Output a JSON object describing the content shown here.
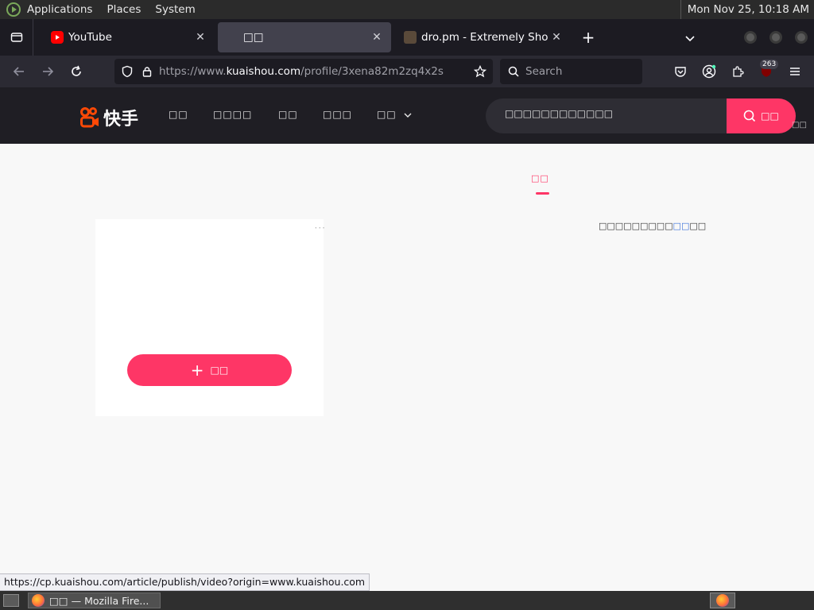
{
  "desktop": {
    "menus": [
      "Applications",
      "Places",
      "System"
    ],
    "clock": "Mon Nov 25, 10:18 AM"
  },
  "browser": {
    "tabs": [
      {
        "title": "YouTube",
        "favicon": "youtube-icon",
        "active": false
      },
      {
        "title": "□□",
        "favicon": "kuaishou-favicon",
        "active": true
      },
      {
        "title": "dro.pm - Extremely Short Li",
        "favicon": "dropm-favicon",
        "active": false
      }
    ],
    "url": {
      "prefix": "https://www.",
      "domain": "kuaishou.com",
      "path": "/profile/3xena82m2zq4x2s"
    },
    "search_placeholder": "Search",
    "extension_badge": "263",
    "status_url": "https://cp.kuaishou.com/article/publish/video?origin=www.kuaishou.com"
  },
  "site": {
    "logo_text": "快手",
    "nav": [
      "□□",
      "□□□□",
      "□□",
      "□□□",
      "□□"
    ],
    "search_placeholder": "□□□□□□□□□□□□",
    "search_button": "□□",
    "header_side_note": "□□",
    "tab_title": "□□",
    "more_icon": "···",
    "upload_label": "□□",
    "notice_text": "□□□□□□□□□",
    "notice_link": "□□",
    "notice_tail": "□□"
  },
  "taskbar": {
    "window_title": "□□ — Mozilla Fire..."
  },
  "colors": {
    "accent": "#fe3666",
    "header_bg": "#1f1e24",
    "browser_chrome": "#2b2a33"
  }
}
